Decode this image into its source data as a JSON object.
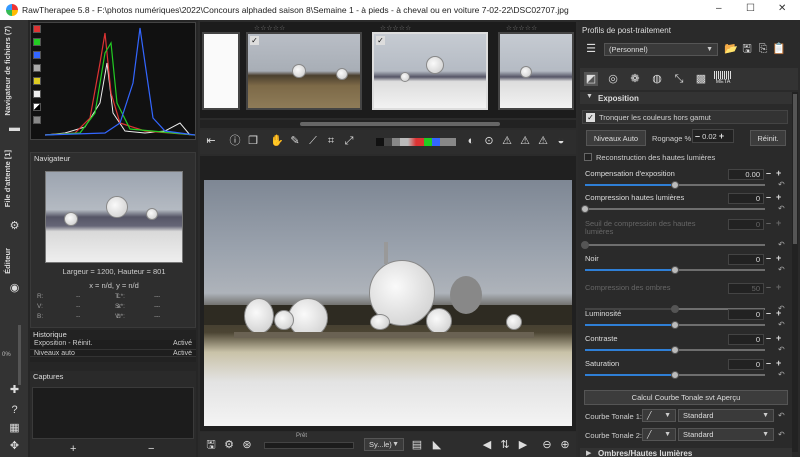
{
  "window": {
    "title": "RawTherapee 5.8 - F:\\photos numériques\\2022\\Concours alphaded saison 8\\Semaine 1 - à pieds - à cheval ou en voiture 7-02-22\\DSC02707.jpg",
    "min": "–",
    "max": "☐",
    "close": "✕"
  },
  "vtabs": {
    "file_browser": "Navigateur de fichiers (7)",
    "queue": "File d'attente [1]",
    "editor": "Éditeur"
  },
  "left": {
    "zoom_pct": "0%"
  },
  "navigator": {
    "title": "Navigateur",
    "dims": "Largeur = 1200, Hauteur = 801",
    "coords": "x = n/d, y = n/d",
    "values": [
      [
        "R:",
        "--",
        "T:",
        "--",
        "L*:",
        "--"
      ],
      [
        "V:",
        "--",
        "S:",
        "--",
        "a*:",
        "--"
      ],
      [
        "B:",
        "--",
        "V:",
        "--",
        "b*:",
        "--"
      ]
    ]
  },
  "history": {
    "title": "Historique",
    "rows": [
      {
        "name": "Exposition - Réinit.",
        "state": "Activé"
      },
      {
        "name": "Niveaux auto",
        "state": "Activé"
      }
    ]
  },
  "captures": {
    "title": "Captures",
    "add": "+",
    "remove": "−"
  },
  "filmstrip": {
    "stars": "☆☆☆☆☆"
  },
  "bottom": {
    "status": "Prêt",
    "stack_label": "Sy...le)"
  },
  "right": {
    "profiles_title": "Profils de post-traitement",
    "profile_value": "(Personnel)",
    "tab_meta": "META",
    "section_exposure": "Exposition",
    "clip_label": "Tronquer les couleurs hors gamut",
    "auto_levels": "Niveaux Auto",
    "clip_pct_label": "Rognage %",
    "clip_pct_value": "0.02",
    "reset": "Réinit.",
    "hl_recon": "Reconstruction des hautes lumières",
    "sliders": [
      {
        "label": "Compensation d'exposition",
        "value": "0.00",
        "fill": 0.5
      },
      {
        "label": "Compression hautes lumières",
        "value": "0",
        "fill": 0.0
      },
      {
        "label": "Seuil de compression des hautes lumières",
        "value": "0",
        "fill": 0.0
      },
      {
        "label": "Noir",
        "value": "0",
        "fill": 0.5
      },
      {
        "label": "Compression des ombres",
        "value": "50",
        "fill": 0.5
      },
      {
        "label": "Luminosité",
        "value": "0",
        "fill": 0.5
      },
      {
        "label": "Contraste",
        "value": "0",
        "fill": 0.5
      },
      {
        "label": "Saturation",
        "value": "0",
        "fill": 0.5
      }
    ],
    "curve_btn": "Calcul Courbe Tonale svt Aperçu",
    "curve1_label": "Courbe Tonale 1:",
    "curve1_mode": "Standard",
    "curve2_label": "Courbe Tonale 2:",
    "curve2_mode": "Standard",
    "next_section": "Ombres/Hautes lumières"
  },
  "colors": {
    "accent": "#2f7fd6",
    "panel": "#2a2a2a"
  }
}
